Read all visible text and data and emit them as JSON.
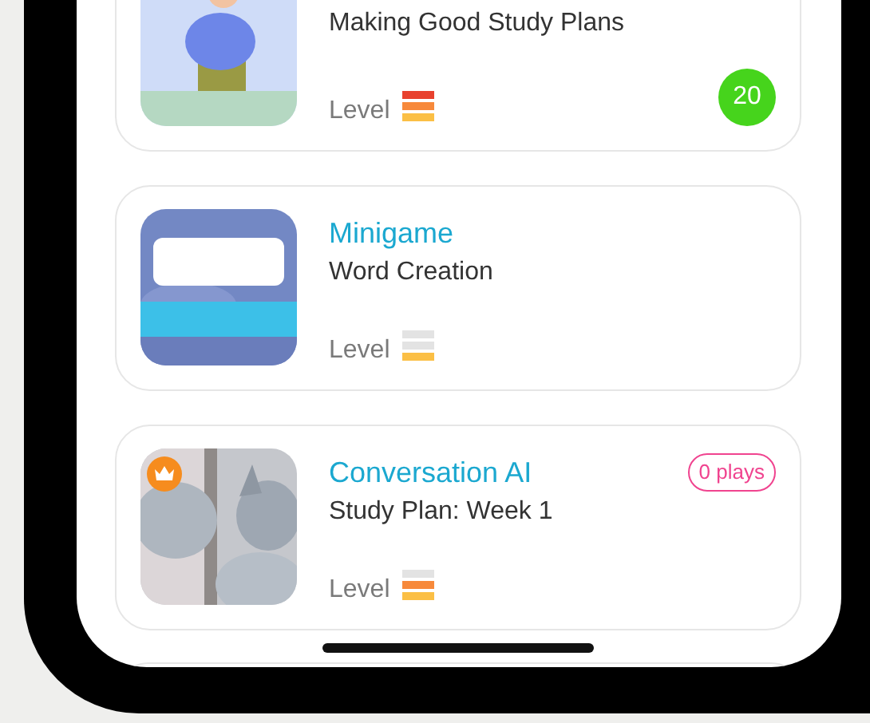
{
  "lessons": [
    {
      "kind": "video",
      "subtitle": "Making Good Study Plans",
      "level_label": "Level",
      "level": 1,
      "score": "20",
      "premium": false
    },
    {
      "kind": "minigame",
      "title": "Minigame",
      "subtitle": "Word Creation",
      "level_label": "Level",
      "level": 0.33,
      "premium": false
    },
    {
      "kind": "conversation",
      "title": "Conversation AI",
      "plays": "0 plays",
      "subtitle": "Study Plan: Week 1",
      "level_label": "Level",
      "level": 0.67,
      "premium": true
    }
  ]
}
